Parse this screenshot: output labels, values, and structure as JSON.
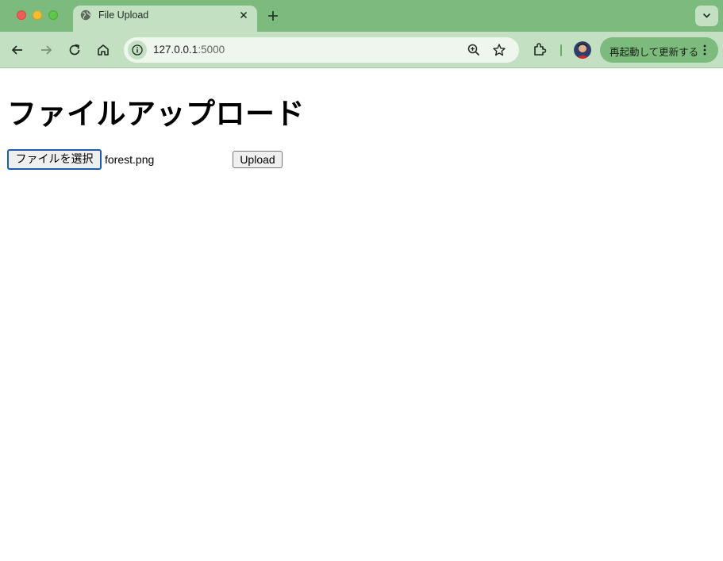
{
  "browser": {
    "tab": {
      "title": "File Upload",
      "icon": "globe-icon"
    },
    "address": {
      "host": "127.0.0.1",
      "port": ":5000"
    },
    "relaunch_label": "再起動して更新する",
    "colors": {
      "frame": "#7dba7d",
      "toolbar": "#c3e0c3",
      "omnibox": "#eef6ee"
    }
  },
  "page": {
    "heading": "ファイルアップロード",
    "file_button_label": "ファイルを選択",
    "file_name": "forest.png",
    "upload_label": "Upload"
  }
}
